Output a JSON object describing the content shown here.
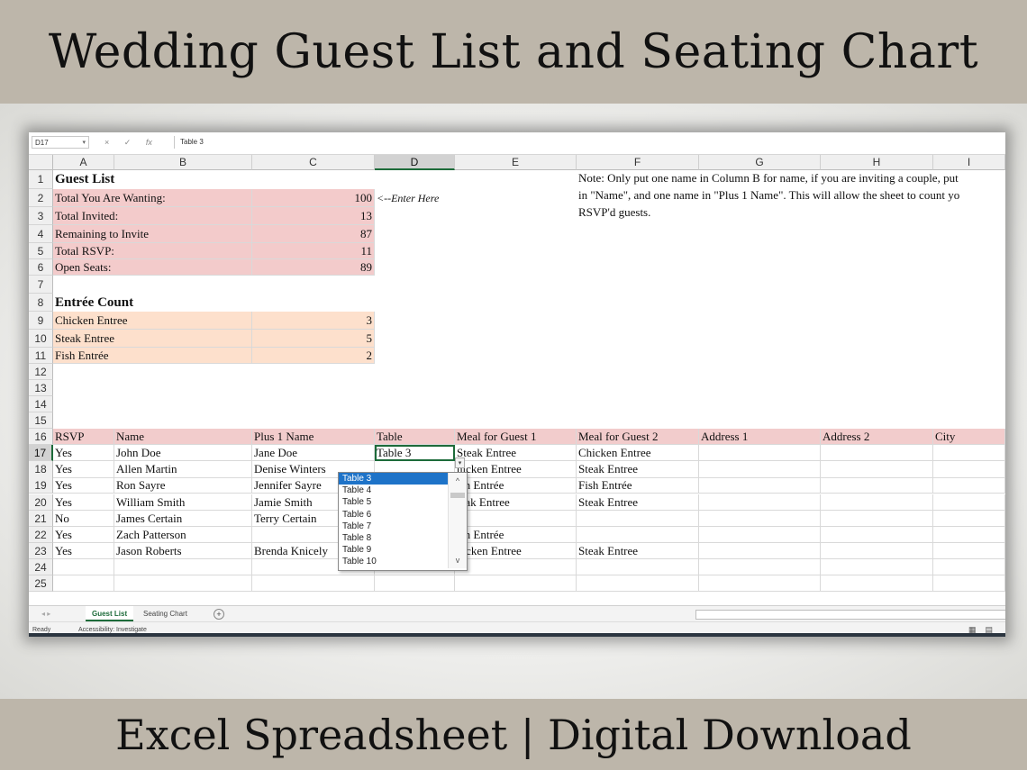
{
  "banner": {
    "title": "Wedding Guest List and Seating Chart",
    "subtitle": "Excel Spreadsheet | Digital Download"
  },
  "formula_bar": {
    "name_box": "D17",
    "cancel_icon": "×",
    "enter_icon": "✓",
    "fx_label": "fx",
    "formula": "Table 3"
  },
  "columns": [
    "A",
    "B",
    "C",
    "D",
    "E",
    "F",
    "G",
    "H",
    "I"
  ],
  "rows": [
    "1",
    "2",
    "3",
    "4",
    "5",
    "6",
    "7",
    "8",
    "9",
    "10",
    "11",
    "12",
    "13",
    "14",
    "15",
    "16",
    "17",
    "18",
    "19",
    "20",
    "21",
    "22",
    "23",
    "24",
    "25"
  ],
  "summary": {
    "guest_list_title": "Guest List",
    "items": [
      {
        "label": "Total You Are Wanting:",
        "value": "100"
      },
      {
        "label": "Total Invited:",
        "value": "13"
      },
      {
        "label": "Remaining to Invite",
        "value": "87"
      },
      {
        "label": "Total RSVP:",
        "value": "11"
      },
      {
        "label": "Open Seats:",
        "value": "89"
      }
    ],
    "enter_here": "<--Enter Here",
    "entree_title": "Entrée Count",
    "entrees": [
      {
        "label": "Chicken Entree",
        "value": "3"
      },
      {
        "label": "Steak Entree",
        "value": "5"
      },
      {
        "label": "Fish Entrée",
        "value": "2"
      }
    ]
  },
  "note": {
    "line1": "Note: Only put one name in Column B for name, if you are inviting a couple, put",
    "line2": "in \"Name\", and one name in \"Plus 1 Name\".  This will allow the sheet to count yo",
    "line3": "RSVP'd guests."
  },
  "table": {
    "headers": [
      "RSVP",
      "Name",
      "Plus 1 Name",
      "Table",
      "Meal for Guest 1",
      "Meal for Guest 2",
      "Address 1",
      "Address 2",
      "City"
    ],
    "rows": [
      [
        "Yes",
        "John Doe",
        "Jane Doe",
        "Table 3",
        "Steak Entree",
        "Chicken Entree"
      ],
      [
        "Yes",
        "Allen Martin",
        "Denise Winters",
        "",
        "hicken Entree",
        "Steak Entree"
      ],
      [
        "Yes",
        "Ron Sayre",
        "Jennifer Sayre",
        "",
        "ish Entrée",
        "Fish Entrée"
      ],
      [
        "Yes",
        "William Smith",
        "Jamie Smith",
        "",
        "teak Entree",
        "Steak Entree"
      ],
      [
        "No",
        "James Certain",
        "Terry Certain",
        "",
        "",
        ""
      ],
      [
        "Yes",
        "Zach Patterson",
        "",
        "",
        "ish Entrée",
        ""
      ],
      [
        "Yes",
        "Jason Roberts",
        "Brenda Knicely",
        "",
        "hicken Entree",
        "Steak Entree"
      ]
    ]
  },
  "dropdown": {
    "selected": "Table 3",
    "options": [
      "Table 3",
      "Table 4",
      "Table 5",
      "Table 6",
      "Table 7",
      "Table 8",
      "Table 9",
      "Table 10"
    ],
    "scroll_up_icon": "^",
    "scroll_down_icon": "v",
    "arrow_icon": "▾"
  },
  "sheet_tabs": {
    "nav": "◂  ▸",
    "tabs": [
      "Guest List",
      "Seating Chart"
    ],
    "add_icon": "+"
  },
  "status": {
    "ready": "Ready",
    "accessibility": "Accessibility: Investigate"
  }
}
